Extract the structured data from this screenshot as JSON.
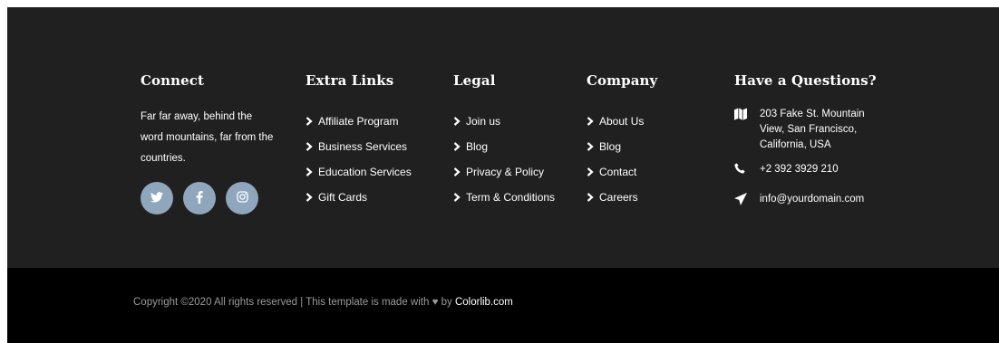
{
  "connect": {
    "title": "Connect",
    "text": "Far far away, behind the word mountains, far from the countries.",
    "social": [
      {
        "icon": "twitter-icon",
        "glyph": "🐦"
      },
      {
        "icon": "facebook-icon",
        "glyph": "f"
      },
      {
        "icon": "instagram-icon",
        "glyph": "◎"
      }
    ]
  },
  "extra_links": {
    "title": "Extra Links",
    "items": [
      "Affiliate Program",
      "Business Services",
      "Education Services",
      "Gift Cards"
    ]
  },
  "legal": {
    "title": "Legal",
    "items": [
      "Join us",
      "Blog",
      "Privacy & Policy",
      "Term & Conditions"
    ]
  },
  "company": {
    "title": "Company",
    "items": [
      "About Us",
      "Blog",
      "Contact",
      "Careers"
    ]
  },
  "questions": {
    "title": "Have a Questions?",
    "address": "203 Fake St. Mountain View, San Francisco, California, USA",
    "phone": "+2 392 3929 210",
    "email": "info@yourdomain.com"
  },
  "footer": {
    "copyright_prefix": "Copyright ©2020 All rights reserved | This template is made with",
    "heart": "♥",
    "by": "by",
    "brand": "Colorlib.com"
  },
  "colors": {
    "top_bg": "#202020",
    "bottom_bg": "#000000",
    "social_bg": "#8fa6bd"
  }
}
